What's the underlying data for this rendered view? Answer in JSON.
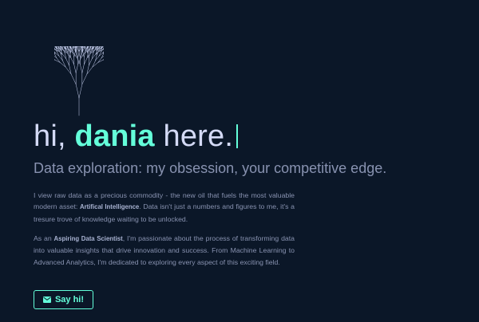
{
  "hero": {
    "greeting": "hi, ",
    "name": "dania",
    "suffix": " here.",
    "tagline": "Data exploration: my obsession, your competitive edge."
  },
  "about": {
    "p1": {
      "pre": "I view raw data as a precious commodity - the new oil that fuels the most valuable modern asset: ",
      "strong": "Artifical Intelligence",
      "post": ". Data isn't just a numbers and figures to me, it's a tresure trove of knowledge waiting to be unlocked."
    },
    "p2": {
      "pre": "As an ",
      "strong": "Aspiring Data Scientist",
      "post": ", I'm passionate about the process of transforming data into valuable insights that drive innovation and success. From Machine Learning to Advanced Analytics, I'm dedicated to exploring every aspect of this exciting field."
    }
  },
  "cta": {
    "label": "Say hi!",
    "icon": "mail-icon"
  },
  "colors": {
    "background": "#0b1728",
    "accent": "#64ffda",
    "heading": "#d4daf6",
    "text": "#8892b0"
  }
}
